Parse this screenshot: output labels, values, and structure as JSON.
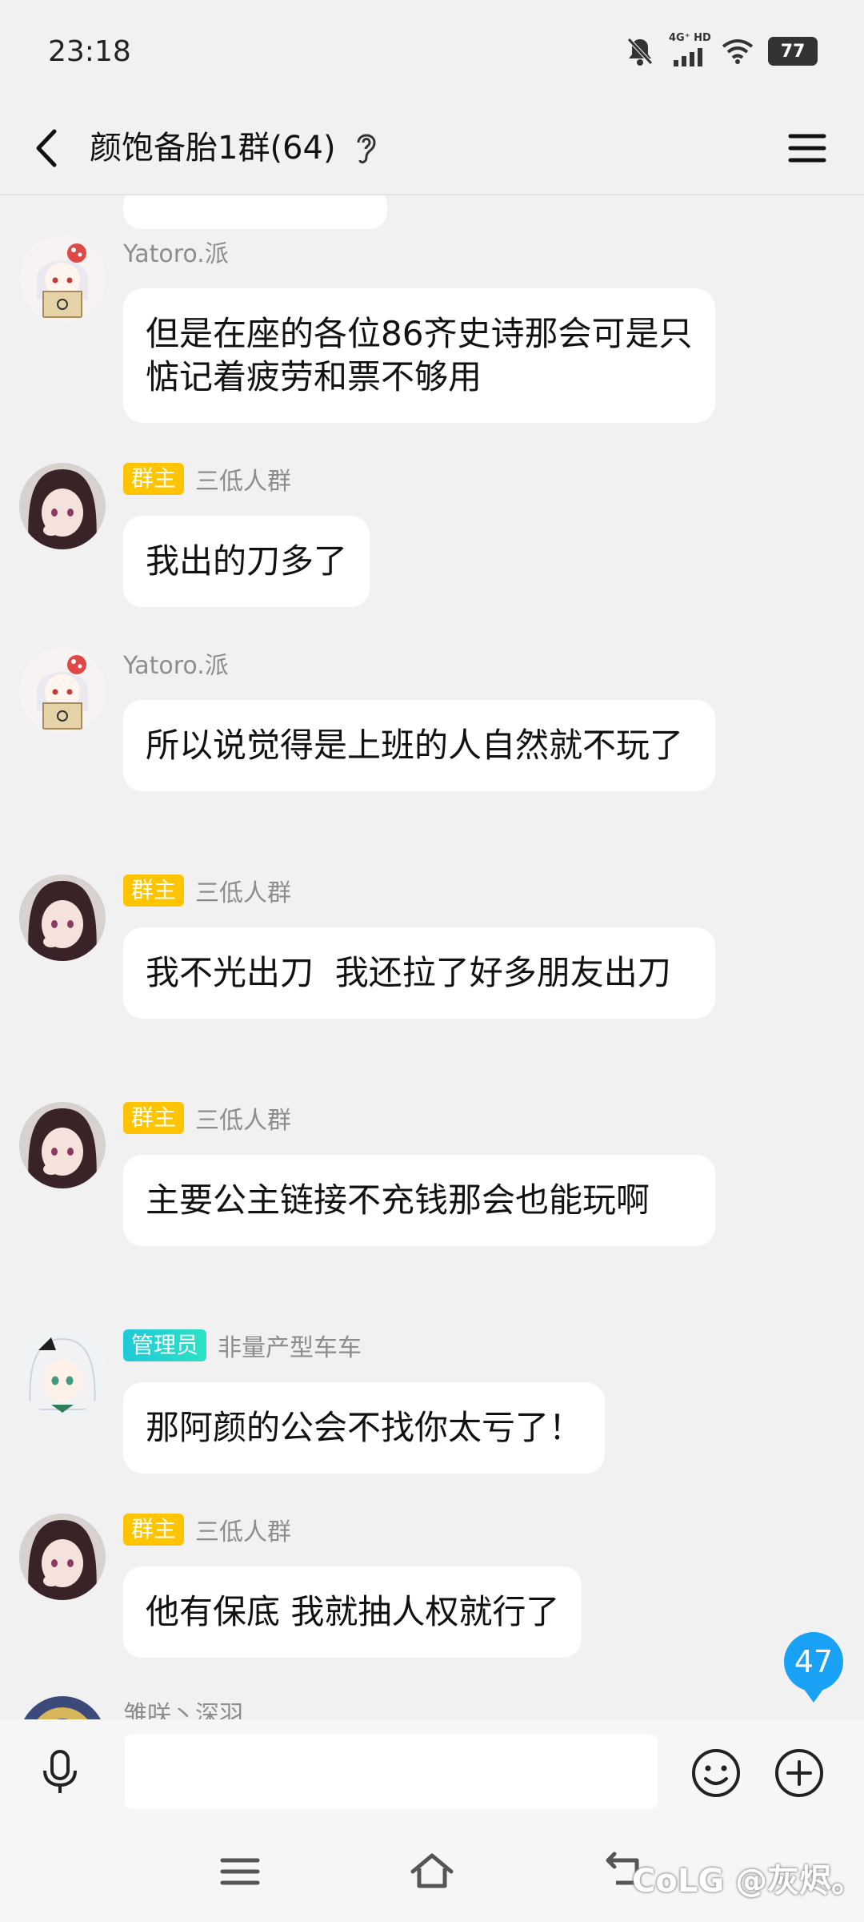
{
  "status": {
    "time": "23:18",
    "network": "4G⁺ HD",
    "battery": "77"
  },
  "header": {
    "title": "颜饱备胎1群(64)"
  },
  "messages": [
    {
      "sender": "Yatoro.派",
      "badge": "",
      "text": "但是在座的各位86齐史诗那会可是只惦记着疲劳和票不够用"
    },
    {
      "sender": "三低人群",
      "badge": "群主",
      "text": "我出的刀多了"
    },
    {
      "sender": "Yatoro.派",
      "badge": "",
      "text": "所以说觉得是上班的人自然就不玩了"
    },
    {
      "sender": "三低人群",
      "badge": "群主",
      "text": "我不光出刀  我还拉了好多朋友出刀"
    },
    {
      "sender": "三低人群",
      "badge": "群主",
      "text": "主要公主链接不充钱那会也能玩啊"
    },
    {
      "sender": "非量产型车车",
      "badge": "管理员",
      "text": "那阿颜的公会不找你太亏了！"
    },
    {
      "sender": "三低人群",
      "badge": "群主",
      "text": "他有保底 我就抽人权就行了"
    },
    {
      "sender": "雏咲丶深羽"
    }
  ],
  "unread_count": "47",
  "watermark": "CoLG @灰烬。"
}
